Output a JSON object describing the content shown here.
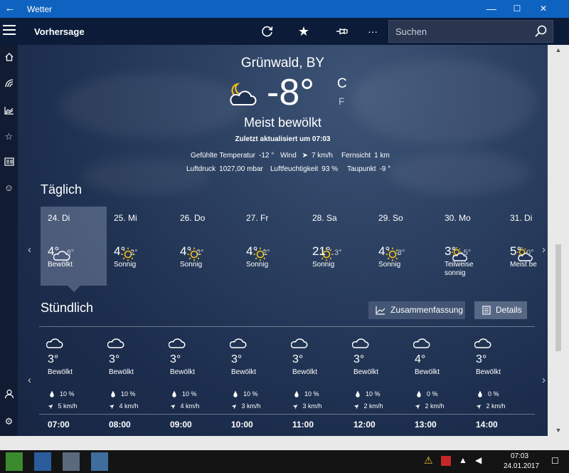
{
  "window": {
    "title": "Wetter"
  },
  "titlebar": {
    "back_icon": "back-arrow-icon",
    "minimize": "—",
    "maximize": "☐",
    "close": "✕"
  },
  "command_bar": {
    "page_title": "Vorhersage",
    "refresh_icon": "refresh-icon",
    "favorite_icon": "star-icon",
    "pin_icon": "pin-icon",
    "more_label": "···",
    "search_placeholder": "Suchen"
  },
  "nav": [
    "home-icon",
    "radar-icon",
    "chart-icon",
    "favorites-icon",
    "news-icon",
    "smiley-icon",
    "account-icon",
    "settings-icon"
  ],
  "current": {
    "location": "Grünwald, BY",
    "temperature": "-8°",
    "unit_c": "C",
    "unit_f": "F",
    "condition": "Meist bewölkt",
    "updated": "Zuletzt aktualisiert um 07:03",
    "details": {
      "feels_label": "Gefühlte Temperatur",
      "feels_value": "-12 °",
      "wind_label": "Wind",
      "wind_value": "7 km/h",
      "visibility_label": "Fernsicht",
      "visibility_value": "1 km",
      "pressure_label": "Luftdruck",
      "pressure_value": "1027,00 mbar",
      "humidity_label": "Luftfeuchtigkeit",
      "humidity_value": "93 %",
      "dewpoint_label": "Taupunkt",
      "dewpoint_value": "-9 °"
    }
  },
  "daily": {
    "title": "Täglich",
    "days": [
      {
        "label": "24. Di",
        "icon": "cloudy-icon",
        "hi": "4°",
        "lo": "-8°",
        "cond": "Bewölkt",
        "selected": true
      },
      {
        "label": "25. Mi",
        "icon": "sunny-icon",
        "hi": "4°",
        "lo": "2°",
        "cond": "Sonnig"
      },
      {
        "label": "26. Do",
        "icon": "sunny-icon",
        "hi": "4°",
        "lo": "2°",
        "cond": "Sonnig"
      },
      {
        "label": "27. Fr",
        "icon": "sunny-icon",
        "hi": "4°",
        "lo": "2°",
        "cond": "Sonnig"
      },
      {
        "label": "28. Sa",
        "icon": "sunny-icon",
        "hi": "21°",
        "lo": "3°",
        "cond": "Sonnig"
      },
      {
        "label": "29. So",
        "icon": "sunny-icon",
        "hi": "4°",
        "lo": "-8°",
        "cond": "Sonnig"
      },
      {
        "label": "30. Mo",
        "icon": "partly-cloudy-icon",
        "hi": "3°",
        "lo": "-5°",
        "cond": "Teilweise sonnig"
      },
      {
        "label": "31. Di",
        "icon": "partly-cloudy-icon",
        "hi": "5°",
        "lo": "0°",
        "cond": "Meist be"
      }
    ]
  },
  "hourly": {
    "title": "Stündlich",
    "summary_button": "Zusammenfassung",
    "details_button": "Details",
    "hours": [
      {
        "time": "07:00",
        "icon": "cloudy-icon",
        "temp": "3°",
        "cond": "Bewölkt",
        "rain": "10 %",
        "wind": "5 km/h"
      },
      {
        "time": "08:00",
        "icon": "cloudy-icon",
        "temp": "3°",
        "cond": "Bewölkt",
        "rain": "10 %",
        "wind": "4 km/h"
      },
      {
        "time": "09:00",
        "icon": "cloudy-icon",
        "temp": "3°",
        "cond": "Bewölkt",
        "rain": "10 %",
        "wind": "4 km/h"
      },
      {
        "time": "10:00",
        "icon": "cloudy-icon",
        "temp": "3°",
        "cond": "Bewölkt",
        "rain": "10 %",
        "wind": "3 km/h"
      },
      {
        "time": "11:00",
        "icon": "cloudy-icon",
        "temp": "3°",
        "cond": "Bewölkt",
        "rain": "10 %",
        "wind": "3 km/h"
      },
      {
        "time": "12:00",
        "icon": "cloudy-icon",
        "temp": "3°",
        "cond": "Bewölkt",
        "rain": "10 %",
        "wind": "2 km/h"
      },
      {
        "time": "13:00",
        "icon": "cloudy-icon",
        "temp": "4°",
        "cond": "Bewölkt",
        "rain": "0 %",
        "wind": "2 km/h"
      },
      {
        "time": "14:00",
        "icon": "cloudy-icon",
        "temp": "3°",
        "cond": "Bewölkt",
        "rain": "0 %",
        "wind": "2 km/h"
      }
    ]
  },
  "taskbar": {
    "time": "07:03",
    "date": "24.01.2017"
  },
  "colors": {
    "titlebar": "#0f63c0",
    "command_bar": "#0c1b38",
    "background": "#1c2d4d",
    "accent_sun": "#f5c518"
  }
}
